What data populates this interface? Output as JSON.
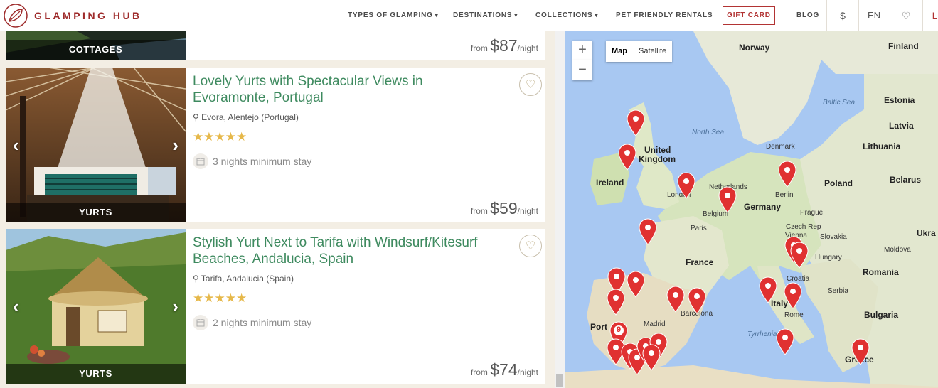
{
  "header": {
    "logo_text": "GLAMPING HUB",
    "nav": [
      {
        "label": "TYPES OF GLAMPING",
        "dropdown": true
      },
      {
        "label": "DESTINATIONS",
        "dropdown": true
      },
      {
        "label": "COLLECTIONS",
        "dropdown": true
      },
      {
        "label": "PET FRIENDLY RENTALS",
        "dropdown": false
      }
    ],
    "gift_card": "GIFT CARD",
    "blog": "BLOG",
    "currency": "$",
    "language": "EN",
    "cut_off_letter": "L"
  },
  "listings": [
    {
      "image_label": "COTTAGES",
      "price_from": "from",
      "price": "$87",
      "per": "/night"
    },
    {
      "title": "Lovely Yurts with Spectacular Views in Evoramonte, Portugal",
      "location": "Evora, Alentejo (Portugal)",
      "rating": 5,
      "stars": "★★★★★",
      "minimum_stay": "3 nights minimum stay",
      "image_label": "YURTS",
      "price_from": "from",
      "price": "$59",
      "per": "/night"
    },
    {
      "title": "Stylish Yurt Next to Tarifa with Windsurf/Kitesurf Beaches, Andalucia, Spain",
      "location": "Tarifa, Andalucia (Spain)",
      "rating": 5,
      "stars": "★★★★★",
      "minimum_stay": "2 nights minimum stay",
      "image_label": "YURTS",
      "price_from": "from",
      "price": "$74",
      "per": "/night"
    }
  ],
  "map": {
    "zoom_in": "+",
    "zoom_out": "−",
    "type_map": "Map",
    "type_satellite": "Satellite",
    "cluster_count": "9",
    "labels": {
      "norway": "Norway",
      "finland": "Finland",
      "estonia": "Estonia",
      "latvia": "Latvia",
      "lithuania": "Lithuania",
      "baltic_sea": "Baltic Sea",
      "north_sea": "North Sea",
      "denmark": "Denmark",
      "united_kingdom_1": "United",
      "united_kingdom_2": "Kingdom",
      "ireland": "Ireland",
      "london": "London",
      "netherlands": "Netherlands",
      "belgium": "Belgium",
      "germany": "Germany",
      "berlin": "Berlin",
      "poland": "Poland",
      "belarus": "Belarus",
      "prague": "Prague",
      "czech_rep": "Czech Rep",
      "vienna": "Vienna",
      "slovakia": "Slovakia",
      "ukraine": "Ukra",
      "moldova": "Moldova",
      "hungary": "Hungary",
      "paris": "Paris",
      "france": "France",
      "croatia": "Croatia",
      "serbia": "Serbia",
      "romania": "Romania",
      "bulgaria": "Bulgaria",
      "italy": "Italy",
      "rome": "Rome",
      "tyrrhenian": "Tyrrhenian",
      "barcelona": "Barcelona",
      "madrid": "Madrid",
      "portugal": "Port",
      "greece": "Greece"
    }
  }
}
